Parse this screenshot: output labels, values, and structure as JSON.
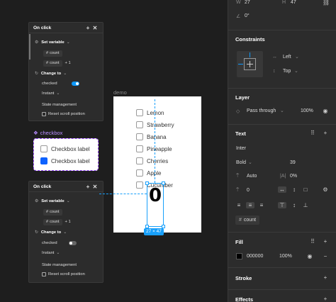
{
  "panel1": {
    "header": "On click",
    "set_variable": "Set variable",
    "var1": "count",
    "var2": "count",
    "plus_one": "+ 1",
    "change_to": "Change to",
    "checked_label": "checked",
    "instant": "Instant",
    "state_mgmt": "State management",
    "reset_scroll": "Reset scroll position"
  },
  "panel2": {
    "header": "On click",
    "set_variable": "Set variable",
    "var1": "count",
    "var2": "count",
    "plus_one": "+ 1",
    "change_to": "Change to",
    "checked_label": "checked",
    "instant": "Instant",
    "state_mgmt": "State management",
    "reset_scroll": "Reset scroll position"
  },
  "canvas": {
    "frame_name": "demo",
    "items": [
      "Lemon",
      "Strawberry",
      "Banana",
      "Pineapple",
      "Cherries",
      "Apple",
      "Cucumber"
    ],
    "counter_value": "0",
    "size_badge": "27 × 47"
  },
  "component": {
    "name": "checkbox",
    "row1": "Checkbox label",
    "row2": "Checkbox label"
  },
  "props": {
    "w_label": "W",
    "w_value": "27",
    "h_label": "H",
    "h_value": "47",
    "rotation": "0°",
    "constraints_title": "Constraints",
    "constraint_h": "Left",
    "constraint_v": "Top",
    "layer_title": "Layer",
    "blend_mode": "Pass through",
    "layer_opacity": "100%",
    "text_title": "Text",
    "font_family": "Inter",
    "font_weight": "Bold",
    "font_size": "39",
    "line_height": "Auto",
    "letter_spacing": "0%",
    "paragraph_spacing": "0",
    "bound_variable": "count",
    "fill_title": "Fill",
    "fill_hex": "000000",
    "fill_opacity": "100%",
    "stroke_title": "Stroke",
    "effects_title": "Effects"
  }
}
